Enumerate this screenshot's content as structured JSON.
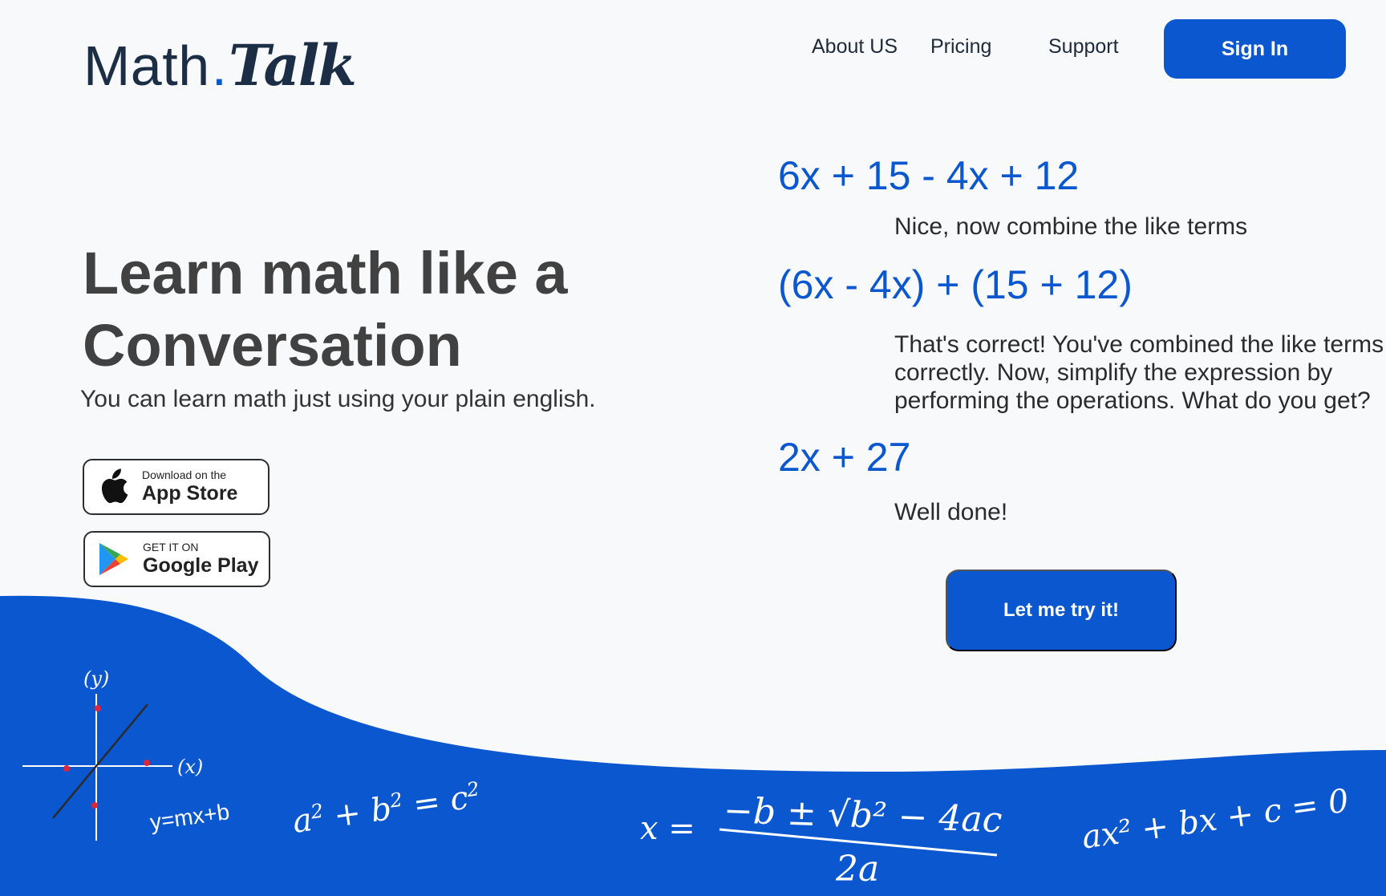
{
  "brand": {
    "part1": "Math",
    "dot": ".",
    "part2": "Talk"
  },
  "nav": {
    "about": "About US",
    "pricing": "Pricing",
    "support": "Support",
    "signin": "Sign In"
  },
  "hero": {
    "headline_line1": "Learn math like a",
    "headline_line2": "Conversation",
    "subtitle": "You can learn math just using your plain english."
  },
  "stores": {
    "apple_small": "Download on the",
    "apple_big": "App Store",
    "google_small": "GET IT ON",
    "google_big": "Google Play"
  },
  "conversation": {
    "eq1": "6x + 15 - 4x + 12",
    "reply1": "Nice, now combine the like terms",
    "eq2": "(6x - 4x) + (15 + 12)",
    "reply2_line1": "That's correct! You've combined the like terms",
    "reply2_line2": "correctly. Now, simplify the expression by",
    "reply2_line3": "performing the operations. What do you get?",
    "eq3": "2x + 27",
    "reply3": "Well done!",
    "try_button": "Let me try it!"
  },
  "decor": {
    "y_axis_label": "(y)",
    "x_axis_label": "(x)",
    "line_eq": "y=mx+b",
    "pythag_a": "a",
    "pythag_b": "b",
    "pythag_c": "c",
    "sq": "2",
    "quad_lhs": "x =",
    "quad_num": "−b ± √b² − 4ac",
    "quad_den": "2a",
    "quad_general": "ax² + bx + c = 0"
  },
  "colors": {
    "primary": "#0b57d0",
    "background": "#f7f9fb",
    "dark": "#1b2e45"
  }
}
